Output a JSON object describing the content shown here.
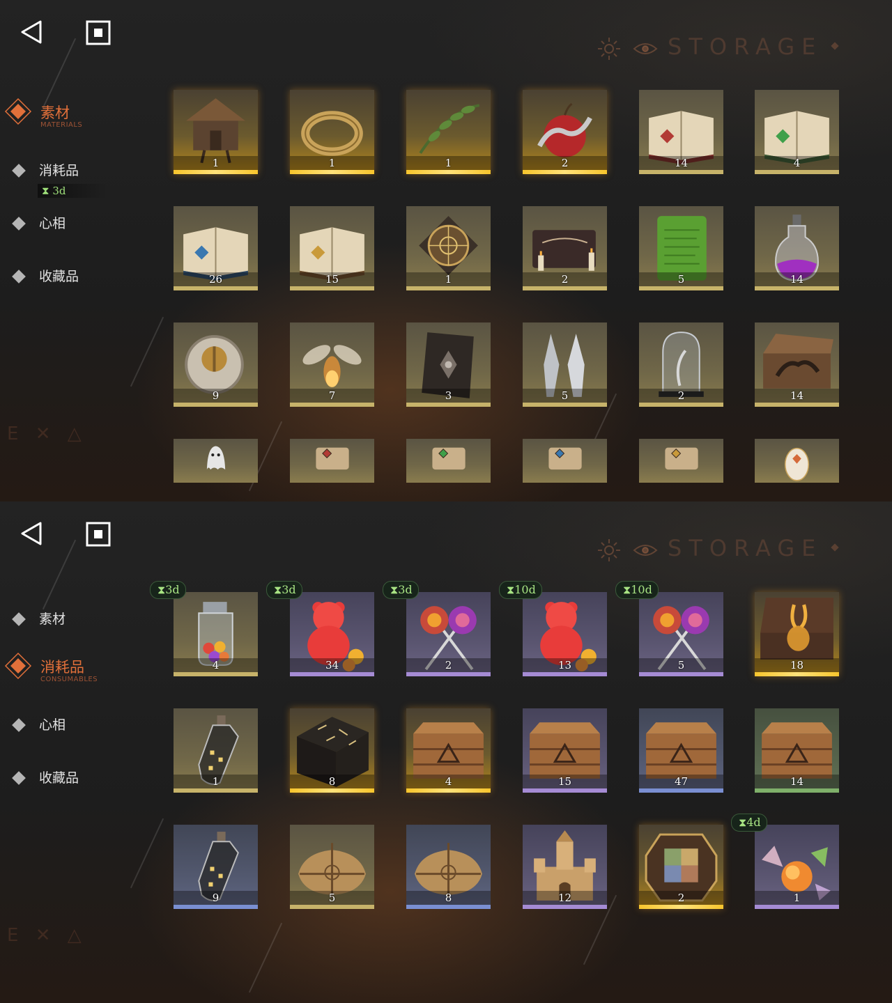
{
  "screens": [
    {
      "storage_title": "STORAGE",
      "nav": {
        "active": {
          "label": "素材",
          "sub": "MATERIALS"
        },
        "items": [
          "消耗品",
          "心相",
          "收藏品"
        ],
        "timer": "3d"
      },
      "items": [
        {
          "name": "hut",
          "count": "1",
          "rarity": "gold"
        },
        {
          "name": "ring",
          "count": "1",
          "rarity": "gold"
        },
        {
          "name": "laurel",
          "count": "1",
          "rarity": "gold"
        },
        {
          "name": "apple",
          "count": "2",
          "rarity": "gold"
        },
        {
          "name": "book-red",
          "count": "14",
          "rarity": "khaki"
        },
        {
          "name": "book-green",
          "count": "4",
          "rarity": "khaki"
        },
        {
          "name": "book-blue",
          "count": "26",
          "rarity": "khaki"
        },
        {
          "name": "book-gold",
          "count": "15",
          "rarity": "khaki"
        },
        {
          "name": "astrolabe",
          "count": "1",
          "rarity": "khaki"
        },
        {
          "name": "ouija",
          "count": "2",
          "rarity": "khaki"
        },
        {
          "name": "green-tablet",
          "count": "5",
          "rarity": "khaki"
        },
        {
          "name": "potion",
          "count": "14",
          "rarity": "khaki"
        },
        {
          "name": "coin",
          "count": "9",
          "rarity": "khaki"
        },
        {
          "name": "firefly",
          "count": "7",
          "rarity": "khaki"
        },
        {
          "name": "dark-book",
          "count": "3",
          "rarity": "khaki"
        },
        {
          "name": "bullets",
          "count": "5",
          "rarity": "khaki"
        },
        {
          "name": "bell-jar",
          "count": "2",
          "rarity": "khaki"
        },
        {
          "name": "hand-box",
          "count": "14",
          "rarity": "khaki"
        },
        {
          "name": "ghost",
          "count": "",
          "rarity": "khaki"
        },
        {
          "name": "scroll-red",
          "count": "",
          "rarity": "khaki"
        },
        {
          "name": "scroll-green",
          "count": "",
          "rarity": "khaki"
        },
        {
          "name": "scroll-blue",
          "count": "",
          "rarity": "khaki"
        },
        {
          "name": "scroll-gold",
          "count": "",
          "rarity": "khaki"
        },
        {
          "name": "egg",
          "count": "",
          "rarity": "khaki"
        }
      ]
    },
    {
      "storage_title": "STORAGE",
      "nav": {
        "active": {
          "label": "消耗品",
          "sub": "CONSUMABLES"
        },
        "items": [
          "素材",
          "心相",
          "收藏品"
        ]
      },
      "items": [
        {
          "name": "candy-jar",
          "count": "4",
          "rarity": "khaki",
          "timer": "3d"
        },
        {
          "name": "gummy-bear",
          "count": "34",
          "rarity": "purple",
          "timer": "3d"
        },
        {
          "name": "lollipops",
          "count": "2",
          "rarity": "purple",
          "timer": "3d"
        },
        {
          "name": "gummy-bear",
          "count": "13",
          "rarity": "purple",
          "timer": "10d"
        },
        {
          "name": "lollipops",
          "count": "5",
          "rarity": "purple",
          "timer": "10d"
        },
        {
          "name": "rabbit-box",
          "count": "18",
          "rarity": "gold"
        },
        {
          "name": "bottle",
          "count": "1",
          "rarity": "khaki"
        },
        {
          "name": "rune-box",
          "count": "8",
          "rarity": "gold"
        },
        {
          "name": "crate",
          "count": "4",
          "rarity": "gold"
        },
        {
          "name": "crate",
          "count": "15",
          "rarity": "purple"
        },
        {
          "name": "crate",
          "count": "47",
          "rarity": "blue"
        },
        {
          "name": "crate",
          "count": "14",
          "rarity": "green"
        },
        {
          "name": "bottle",
          "count": "9",
          "rarity": "blue"
        },
        {
          "name": "parcel",
          "count": "5",
          "rarity": "khaki"
        },
        {
          "name": "parcel",
          "count": "8",
          "rarity": "blue"
        },
        {
          "name": "castle",
          "count": "12",
          "rarity": "purple"
        },
        {
          "name": "puzzle",
          "count": "2",
          "rarity": "gold"
        },
        {
          "name": "candies",
          "count": "1",
          "rarity": "purple",
          "timer": "4d"
        }
      ]
    }
  ]
}
